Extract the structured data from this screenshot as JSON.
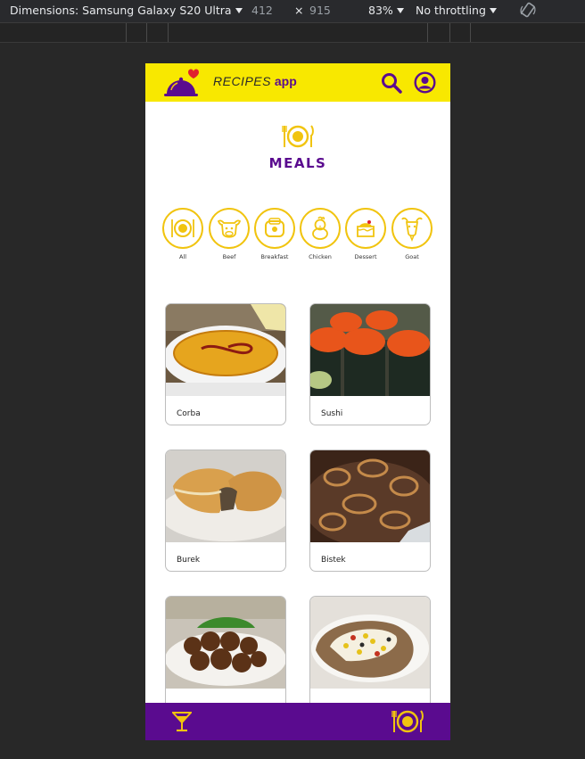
{
  "devtools": {
    "dimensions_label": "Dimensions: Samsung Galaxy S20 Ultra",
    "width_value": "412",
    "times": "×",
    "height_value": "915",
    "zoom": "83%",
    "throttling": "No throttling",
    "rotate_icon": "rotate-icon"
  },
  "app": {
    "title_part1": "RECIPES",
    "title_part2": "app",
    "colors": {
      "brand_yellow": "#f8e800",
      "brand_purple": "#5a0b8f",
      "accent_gold": "#f1c40f"
    }
  },
  "header": {
    "section_title": "MEALS"
  },
  "categories": [
    {
      "label": "All",
      "icon": "plate-icon"
    },
    {
      "label": "Beef",
      "icon": "cow-icon"
    },
    {
      "label": "Breakfast",
      "icon": "toaster-icon"
    },
    {
      "label": "Chicken",
      "icon": "chicken-icon"
    },
    {
      "label": "Dessert",
      "icon": "cake-icon"
    },
    {
      "label": "Goat",
      "icon": "goat-icon"
    }
  ],
  "meals": [
    {
      "name": "Corba"
    },
    {
      "name": "Sushi"
    },
    {
      "name": "Burek"
    },
    {
      "name": "Bistek"
    },
    {
      "name": ""
    },
    {
      "name": ""
    }
  ],
  "footer": {
    "drinks_icon": "cocktail-icon",
    "meals_icon": "plate-icon"
  }
}
